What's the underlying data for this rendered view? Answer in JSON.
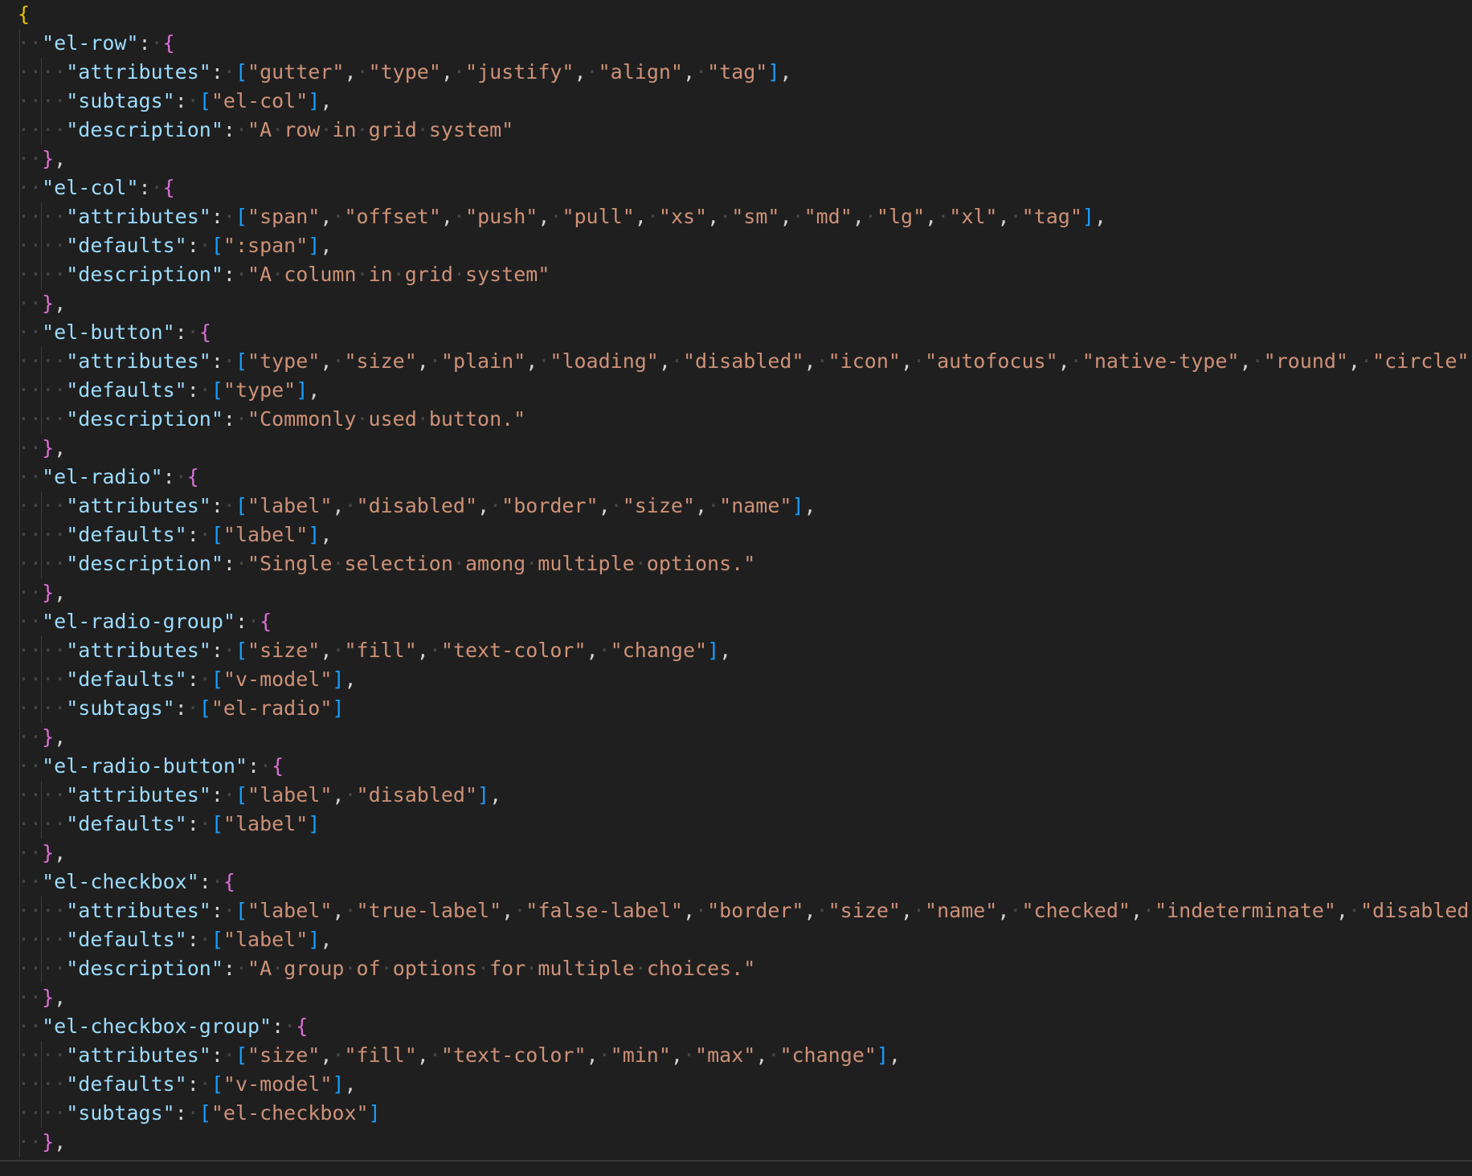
{
  "colors": {
    "background": "#1f1f1f",
    "key": "#9cdcfe",
    "string": "#ce9178",
    "punctuation": "#d4d4d4",
    "root_brace": "#e5c400",
    "object_brace": "#da70d6",
    "array_bracket": "#179fff",
    "whitespace": "#464646"
  },
  "document": {
    "open_brace": "{",
    "entries": [
      {
        "tag": "el-row",
        "props": [
          {
            "key": "attributes",
            "values": [
              "gutter",
              "type",
              "justify",
              "align",
              "tag"
            ]
          },
          {
            "key": "subtags",
            "values": [
              "el-col"
            ]
          },
          {
            "key": "description",
            "text": "A row in grid system"
          }
        ]
      },
      {
        "tag": "el-col",
        "props": [
          {
            "key": "attributes",
            "values": [
              "span",
              "offset",
              "push",
              "pull",
              "xs",
              "sm",
              "md",
              "lg",
              "xl",
              "tag"
            ]
          },
          {
            "key": "defaults",
            "values": [
              ":span"
            ]
          },
          {
            "key": "description",
            "text": "A column in grid system"
          }
        ]
      },
      {
        "tag": "el-button",
        "props": [
          {
            "key": "attributes",
            "values": [
              "type",
              "size",
              "plain",
              "loading",
              "disabled",
              "icon",
              "autofocus",
              "native-type",
              "round",
              "circle"
            ]
          },
          {
            "key": "defaults",
            "values": [
              "type"
            ]
          },
          {
            "key": "description",
            "text": "Commonly used button."
          }
        ]
      },
      {
        "tag": "el-radio",
        "props": [
          {
            "key": "attributes",
            "values": [
              "label",
              "disabled",
              "border",
              "size",
              "name"
            ]
          },
          {
            "key": "defaults",
            "values": [
              "label"
            ]
          },
          {
            "key": "description",
            "text": "Single selection among multiple options."
          }
        ]
      },
      {
        "tag": "el-radio-group",
        "props": [
          {
            "key": "attributes",
            "values": [
              "size",
              "fill",
              "text-color",
              "change"
            ]
          },
          {
            "key": "defaults",
            "values": [
              "v-model"
            ]
          },
          {
            "key": "subtags",
            "values": [
              "el-radio"
            ]
          }
        ]
      },
      {
        "tag": "el-radio-button",
        "props": [
          {
            "key": "attributes",
            "values": [
              "label",
              "disabled"
            ]
          },
          {
            "key": "defaults",
            "values": [
              "label"
            ]
          }
        ]
      },
      {
        "tag": "el-checkbox",
        "props": [
          {
            "key": "attributes",
            "values": [
              "label",
              "true-label",
              "false-label",
              "border",
              "size",
              "name",
              "checked",
              "indeterminate",
              "disabled"
            ]
          },
          {
            "key": "defaults",
            "values": [
              "label"
            ]
          },
          {
            "key": "description",
            "text": "A group of options for multiple choices."
          }
        ]
      },
      {
        "tag": "el-checkbox-group",
        "props": [
          {
            "key": "attributes",
            "values": [
              "size",
              "fill",
              "text-color",
              "min",
              "max",
              "change"
            ]
          },
          {
            "key": "defaults",
            "values": [
              "v-model"
            ]
          },
          {
            "key": "subtags",
            "values": [
              "el-checkbox"
            ]
          }
        ]
      }
    ]
  }
}
